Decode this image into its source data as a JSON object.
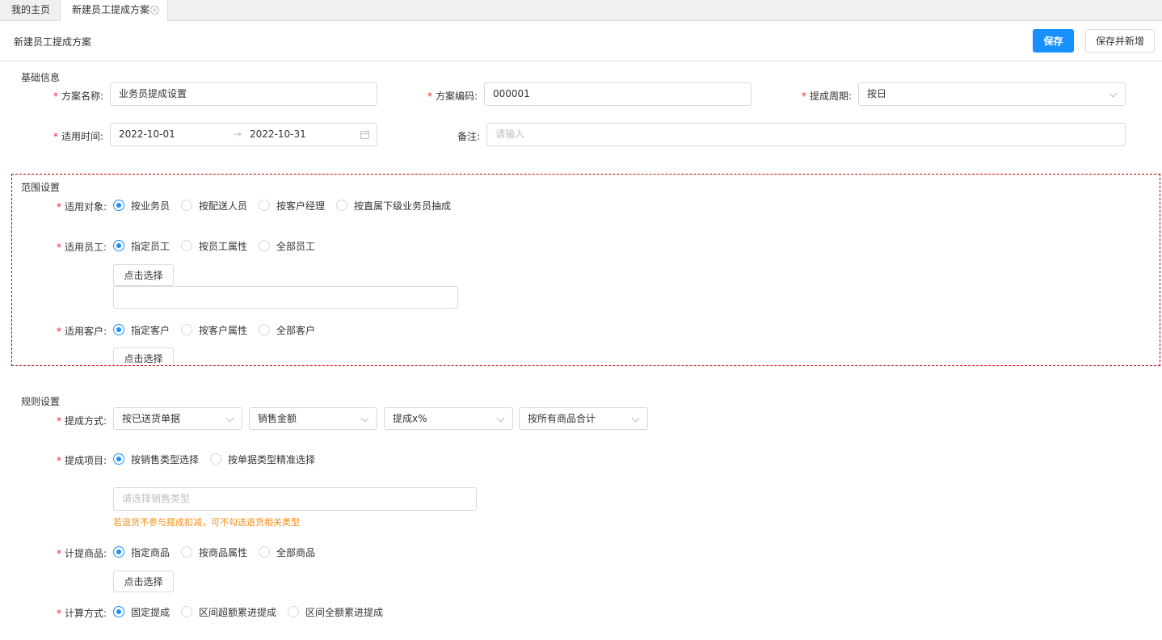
{
  "tabs": {
    "home": "我的主页",
    "active": "新建员工提成方案",
    "close_icon": "close-circle-icon"
  },
  "header": {
    "title": "新建员工提成方案",
    "save": "保存",
    "save_and_new": "保存并新增"
  },
  "basic": {
    "section_title": "基础信息",
    "scheme_name": {
      "label": "方案名称:",
      "value": "业务员提成设置"
    },
    "scheme_code": {
      "label": "方案编码:",
      "value": "000001"
    },
    "period": {
      "label": "提成周期:",
      "value": "按日"
    },
    "apply_time": {
      "label": "适用时间:",
      "start": "2022-10-01",
      "sep": "→",
      "end": "2022-10-31"
    },
    "remark": {
      "label": "备注:",
      "placeholder": "请输入"
    }
  },
  "scope": {
    "section_title": "范围设置",
    "target": {
      "label": "适用对象:",
      "options": [
        "按业务员",
        "按配送人员",
        "按客户经理",
        "按直属下级业务员抽成"
      ],
      "selected": 0
    },
    "employee": {
      "label": "适用员工:",
      "options": [
        "指定员工",
        "按员工属性",
        "全部员工"
      ],
      "selected": 0,
      "select_btn": "点击选择"
    },
    "customer": {
      "label": "适用客户:",
      "options": [
        "指定客户",
        "按客户属性",
        "全部客户"
      ],
      "selected": 0,
      "select_btn": "点击选择"
    }
  },
  "rules": {
    "section_title": "规则设置",
    "method": {
      "label": "提成方式:",
      "selects": [
        "按已送货单据",
        "销售金额",
        "提成x%",
        "按所有商品合计"
      ]
    },
    "item": {
      "label": "提成项目:",
      "options": [
        "按销售类型选择",
        "按单据类型精准选择"
      ],
      "selected": 0,
      "placeholder": "请选择销售类型",
      "hint": "若退货不参与提成扣减，可不勾选退货相关类型"
    },
    "goods": {
      "label": "计提商品:",
      "options": [
        "指定商品",
        "按商品属性",
        "全部商品"
      ],
      "selected": 0,
      "select_btn": "点击选择"
    },
    "calc": {
      "label": "计算方式:",
      "options": [
        "固定提成",
        "区间超额累进提成",
        "区间全额累进提成"
      ],
      "selected": 0
    }
  },
  "colors": {
    "primary": "#1890ff",
    "required": "#f5222d",
    "hint": "#fa8c16",
    "dashed_border": "#c00000"
  }
}
